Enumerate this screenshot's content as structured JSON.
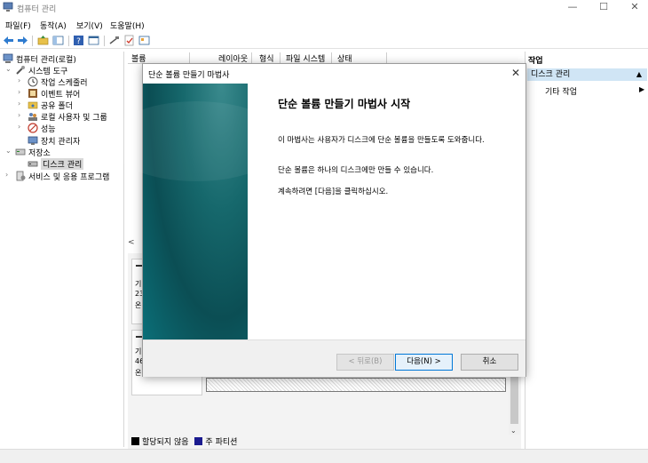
{
  "window": {
    "title": "컴퓨터 관리",
    "minimize": "—",
    "maximize": "☐",
    "close": "✕"
  },
  "menu": {
    "file": "파일(F)",
    "action": "동작(A)",
    "view": "보기(V)",
    "help": "도움말(H)"
  },
  "tree": {
    "root": "컴퓨터 관리(로컬)",
    "system_tools": "시스템 도구",
    "task_scheduler": "작업 스케줄러",
    "event_viewer": "이벤트 뷰어",
    "shared_folders": "공유 폴더",
    "local_users": "로컬 사용자 및 그룹",
    "performance": "성능",
    "device_manager": "장치 관리자",
    "storage": "저장소",
    "disk_management": "디스크 관리",
    "services_apps": "서비스 및 응용 프로그램"
  },
  "columns": {
    "volume": "볼륨",
    "layout": "레이아웃",
    "type": "형식",
    "filesystem": "파일 시스템",
    "status": "상태"
  },
  "disks": [
    {
      "label": "기",
      "size": "23",
      "state": "온"
    },
    {
      "label": "기",
      "size": "46",
      "state": "온"
    }
  ],
  "legend": {
    "unallocated": "할당되지 않음",
    "primary": "주 파티션"
  },
  "actions": {
    "title": "작업",
    "section": "디스크 관리",
    "more": "기타 작업",
    "collapse": "▲",
    "submenu": "▶"
  },
  "wizard": {
    "title": "단순 볼륨 만들기 마법사",
    "heading": "단순 볼륨 만들기 마법사 시작",
    "p1": "이 마법사는 사용자가 디스크에 단순 볼륨을 만들도록 도와줍니다.",
    "p2": "단순 볼륨은 하나의 디스크에만 만들 수 있습니다.",
    "p3": "계속하려면 [다음]을 클릭하십시오.",
    "back": "< 뒤로(B)",
    "next": "다음(N) >",
    "cancel": "취소",
    "close": "✕"
  },
  "colors": {
    "accent": "#0078d7",
    "selection": "#d0e5f5",
    "wizard_panel": "#0b5f66",
    "primary_partition": "#1b1b8f"
  }
}
